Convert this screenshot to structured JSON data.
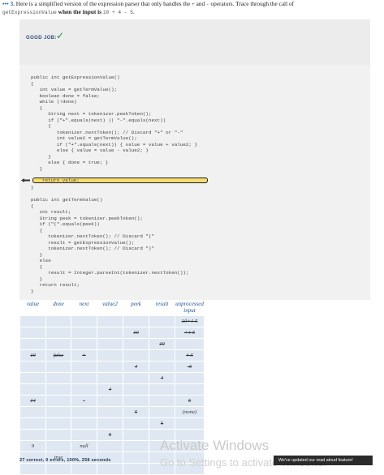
{
  "question": {
    "number_prefix": "••• 3.",
    "text_a": "Here is a simplified version of the expression parser that only handles the",
    "op_plus": "+",
    "text_and": "and",
    "op_minus": "-",
    "text_b": "operators. Trace through the call of",
    "fn_name": "getExpressionValue",
    "text_c": "when the input is",
    "input_expr": "10 + 4 - 5",
    "text_end": "."
  },
  "feedback": {
    "label": "GOOD JOB:",
    "icon": "check-icon",
    "icon_color": "#1f8f4a"
  },
  "code": {
    "lines": "public int getExpressionValue()\n{\n   int value = getTermValue();\n   boolean done = false;\n   while (!done)\n   {\n      String next = tokenizer.peekToken();\n      if (\"+\".equals(next) || \"-\".equals(next))\n      {\n         tokenizer.nextToken(); // Discard \"+\" or \"-\"\n         int value2 = getTermValue();\n         if (\"+\".equals(next)) { value = value + value2; }\n         else { value = value - value2; }\n      }\n      else { done = true; }\n   }",
    "highlighted_line": "return value;",
    "lines2": "}\n\npublic int getTermValue()\n{\n   int result;\n   String peek = tokenizer.peekToken();\n   if (\"(\".equals(peek))\n   {\n      tokenizer.nextToken(); // Discard \"(\"\n      result = getExpressionValue();\n      tokenizer.nextToken(); // Discard \")\"\n   }\n   else\n   {\n      result = Integer.parseInt(tokenizer.nextToken());\n   }\n   return result;\n}",
    "highlight_color": "#f7dc6f"
  },
  "trace": {
    "headers": [
      "value",
      "done",
      "next",
      "value2",
      "peek",
      "result",
      "unprocessed input"
    ],
    "rows": [
      [
        "",
        "",
        "",
        "",
        "",
        "",
        "10+4-5"
      ],
      [
        "",
        "",
        "",
        "",
        "10",
        "",
        "+4-5"
      ],
      [
        "",
        "",
        "",
        "",
        "",
        "10",
        ""
      ],
      [
        "10",
        "false",
        "+",
        "",
        "",
        "",
        "4-5"
      ],
      [
        "",
        "",
        "",
        "",
        "4",
        "",
        "-5"
      ],
      [
        "",
        "",
        "",
        "",
        "",
        "4",
        ""
      ],
      [
        "",
        "",
        "",
        "4",
        "",
        "",
        ""
      ],
      [
        "14",
        "",
        "-",
        "",
        "",
        "",
        "5"
      ],
      [
        "",
        "",
        "",
        "",
        "5",
        "",
        "(none)"
      ],
      [
        "",
        "",
        "",
        "",
        "",
        "5",
        ""
      ],
      [
        "",
        "",
        "",
        "5",
        "",
        "",
        ""
      ],
      [
        "9",
        "",
        "null",
        "",
        "",
        "",
        ""
      ],
      [
        "",
        "true",
        "",
        "",
        "",
        "",
        ""
      ],
      [
        "",
        "",
        "",
        "",
        "",
        "",
        ""
      ]
    ],
    "struck": [
      [
        0,
        6
      ],
      [
        1,
        4
      ],
      [
        1,
        6
      ],
      [
        2,
        5
      ],
      [
        3,
        0
      ],
      [
        3,
        1
      ],
      [
        3,
        2
      ],
      [
        3,
        6
      ],
      [
        4,
        4
      ],
      [
        4,
        6
      ],
      [
        5,
        5
      ],
      [
        6,
        3
      ],
      [
        7,
        0
      ],
      [
        7,
        2
      ],
      [
        7,
        6
      ],
      [
        8,
        4
      ],
      [
        9,
        5
      ],
      [
        10,
        3
      ]
    ],
    "cell_color": "#dfe8f2",
    "header_color": "#1e4f9c"
  },
  "status": "27 correct, 0 errors, 100%, 258 seconds",
  "watermark": {
    "line1": "Activate Windows",
    "line2": "Go to Settings to activate Windows."
  },
  "toast": "We've updated our read aloud feature!"
}
